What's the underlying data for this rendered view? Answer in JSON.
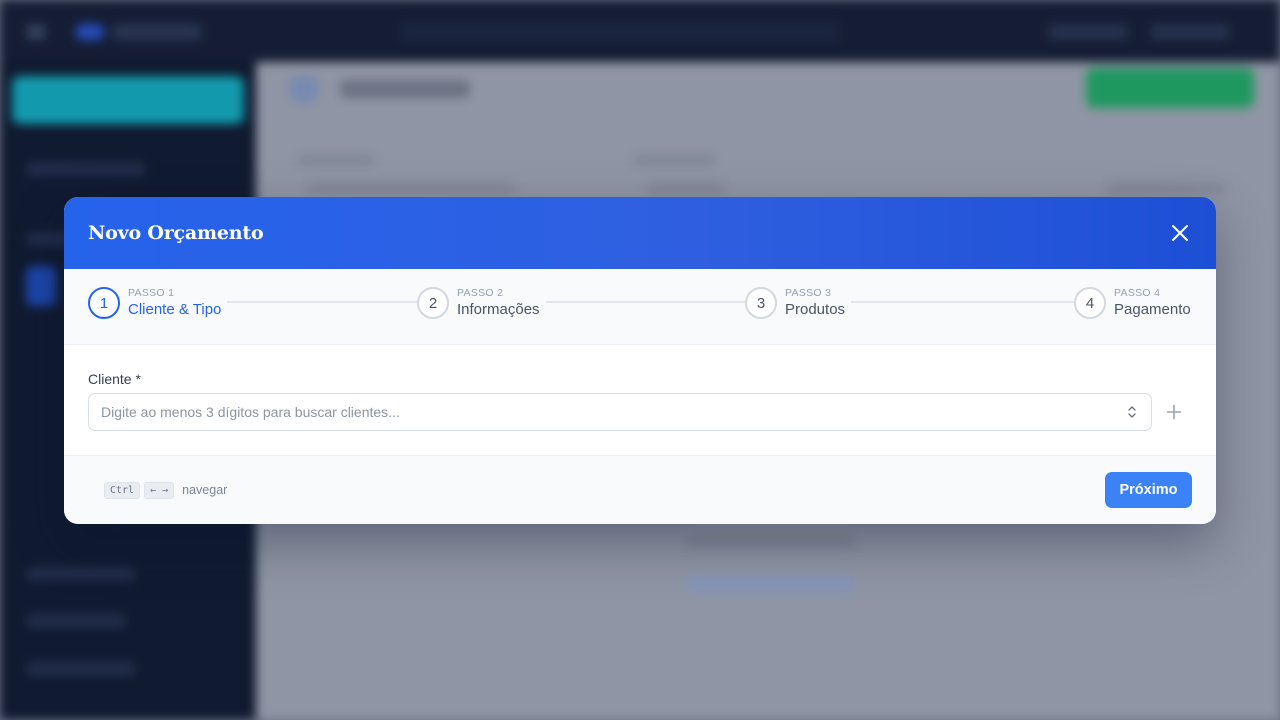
{
  "modal": {
    "title": "Novo Orçamento",
    "steps": [
      {
        "kicker": "PASSO 1",
        "label": "Cliente & Tipo",
        "number": "1",
        "active": true
      },
      {
        "kicker": "PASSO 2",
        "label": "Informações",
        "number": "2",
        "active": false
      },
      {
        "kicker": "PASSO 3",
        "label": "Produtos",
        "number": "3",
        "active": false
      },
      {
        "kicker": "PASSO 4",
        "label": "Pagamento",
        "number": "4",
        "active": false
      }
    ],
    "client_field": {
      "label": "Cliente *",
      "placeholder": "Digite ao menos 3 dígitos para buscar clientes...",
      "value": ""
    },
    "footer": {
      "kbd_ctrl": "Ctrl",
      "kbd_arrows": "← →",
      "hint": "navegar",
      "next_label": "Próximo"
    }
  },
  "colors": {
    "accent": "#2563eb",
    "button": "#3b82f6",
    "header_bg": "#2563eb",
    "sidebar_bg": "#0f1a30",
    "topbar_bg": "#141e35",
    "success": "#22c55e",
    "teal": "#06b6d4"
  },
  "icons": {
    "close": "close-icon",
    "select_arrows": "chevron-up-down-icon",
    "add": "plus-icon"
  }
}
